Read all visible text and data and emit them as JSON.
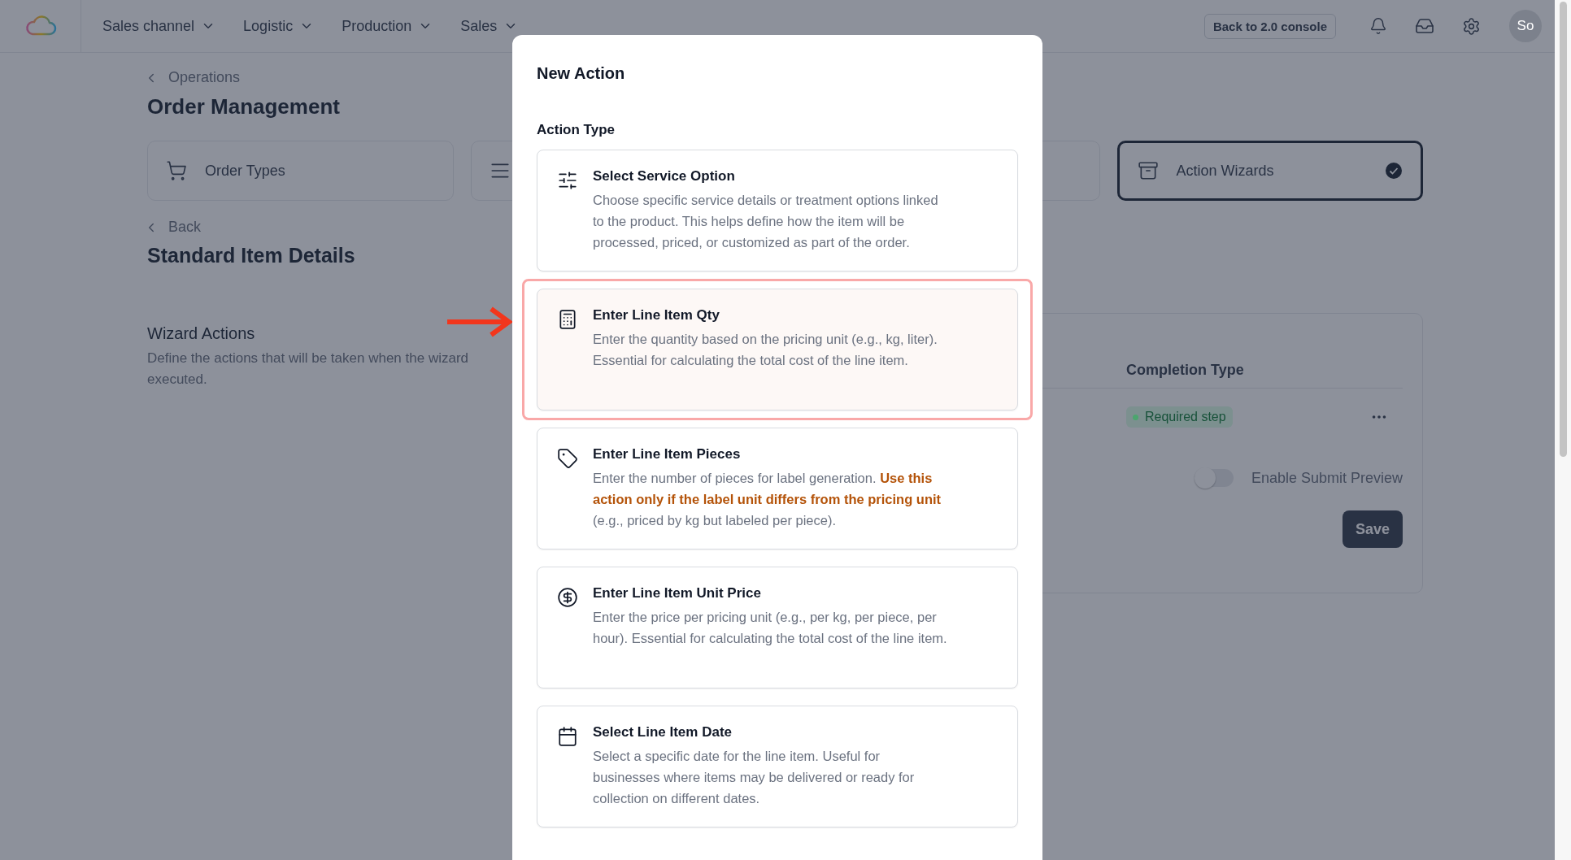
{
  "top_nav": {
    "menus": [
      {
        "label": "Sales channel"
      },
      {
        "label": "Logistic"
      },
      {
        "label": "Production"
      },
      {
        "label": "Sales"
      }
    ],
    "console_button": "Back to 2.0 console",
    "avatar": "So"
  },
  "page": {
    "breadcrumb": "Operations",
    "title": "Order Management",
    "tabs": [
      {
        "kind": "cart",
        "label": "Order Types",
        "selected": false
      },
      {
        "kind": "list",
        "selected": false
      },
      {
        "kind": "blank",
        "selected": false
      },
      {
        "kind": "wizard",
        "label": "Action Wizards",
        "selected": true
      }
    ],
    "back": "Back",
    "subtitle": "Standard Item Details",
    "section": {
      "title": "Wizard Actions",
      "description_lines": [
        "Define the actions that will be taken when the wizard",
        "executed."
      ]
    },
    "table": {
      "column": "Completion Type",
      "rows": [
        {
          "completion": "Required step",
          "color": "#4ca56e"
        }
      ]
    },
    "toggle": {
      "label": "Enable Submit Preview",
      "on": false
    },
    "save": "Save"
  },
  "modal": {
    "title": "New Action",
    "section_label": "Action Type",
    "options": [
      {
        "kind": "sliders",
        "title": "Select Service Option",
        "description": "Choose specific service details or treatment options linked to the product. This helps define how the item will be processed, priced, or customized as part of the order.",
        "highlighted": false
      },
      {
        "kind": "calculator",
        "title": "Enter Line Item Qty",
        "description": "Enter the quantity based on the pricing unit (e.g., kg, liter). Essential for calculating the total cost of the line item.",
        "highlighted": true
      },
      {
        "kind": "tag",
        "title": "Enter Line Item Pieces",
        "description": "Enter the number of pieces for label generation. **Use this action only if the label unit differs from the pricing unit** (e.g., priced by kg but labeled per piece).",
        "highlighted": false
      },
      {
        "kind": "dollar",
        "title": "Enter Line Item Unit Price",
        "description": "Enter the price per pricing unit (e.g., per kg, per piece, per hour). Essential for calculating the total cost of the line item.",
        "highlighted": false
      },
      {
        "kind": "calendar",
        "title": "Select Line Item Date",
        "description": "Select a specific date for the line item. Useful for businesses where items may be delivered or ready for collection on different dates.",
        "highlighted": false
      }
    ]
  }
}
